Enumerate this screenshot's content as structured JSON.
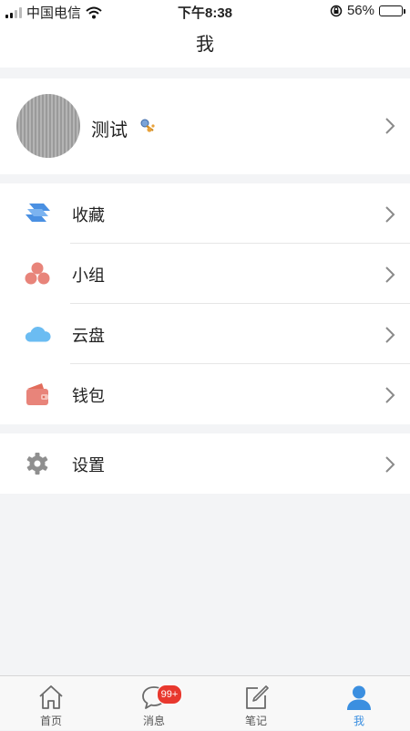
{
  "status_bar": {
    "carrier": "中国电信",
    "time": "下午8:38",
    "battery_percent": "56%",
    "battery_level": 0.56
  },
  "header": {
    "title": "我"
  },
  "profile": {
    "name": "测试"
  },
  "menu_group_1": [
    {
      "label": "收藏",
      "icon": "stack-layers-icon"
    },
    {
      "label": "小组",
      "icon": "group-circles-icon"
    },
    {
      "label": "云盘",
      "icon": "cloud-icon"
    },
    {
      "label": "钱包",
      "icon": "wallet-icon"
    }
  ],
  "menu_group_2": [
    {
      "label": "设置",
      "icon": "gear-icon"
    }
  ],
  "tabbar": {
    "tabs": [
      {
        "label": "首页",
        "icon": "home-icon"
      },
      {
        "label": "消息",
        "icon": "chat-bubble-icon",
        "badge": "99+"
      },
      {
        "label": "笔记",
        "icon": "note-edit-icon"
      },
      {
        "label": "我",
        "icon": "person-icon",
        "active": true
      }
    ]
  },
  "colors": {
    "accent": "#3b8fe0",
    "badge": "#e8382e",
    "background": "#f3f4f6"
  }
}
